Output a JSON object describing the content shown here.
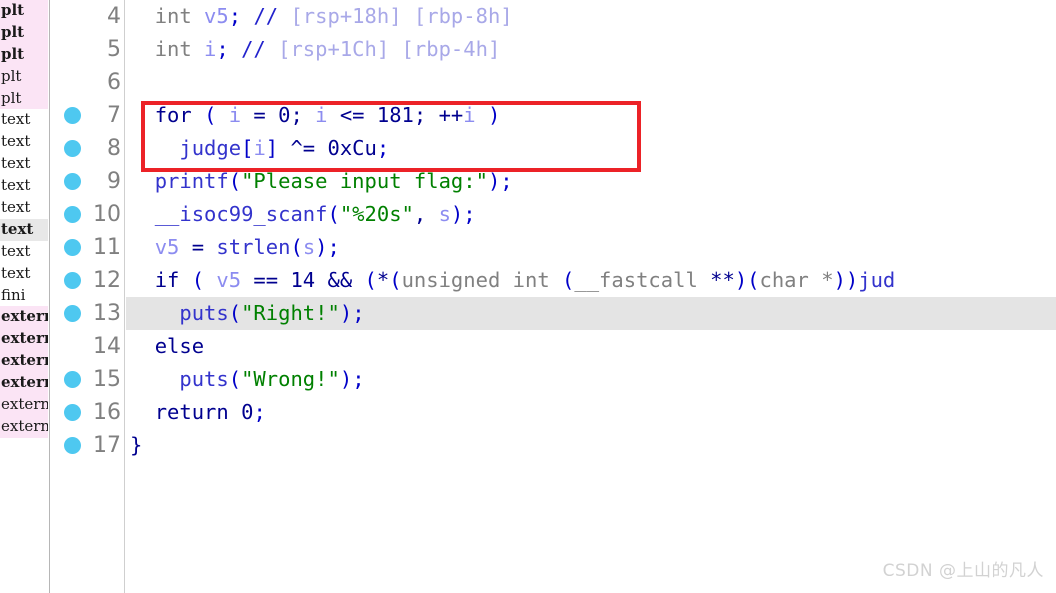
{
  "segment_strip": {
    "rows": [
      {
        "label": "plt",
        "style": "pink",
        "bold": true
      },
      {
        "label": "plt",
        "style": "pink",
        "bold": true
      },
      {
        "label": "plt",
        "style": "pink",
        "bold": true
      },
      {
        "label": "plt",
        "style": "pink",
        "bold": false
      },
      {
        "label": "plt",
        "style": "pink",
        "bold": false
      },
      {
        "label": "text",
        "style": "white",
        "bold": false
      },
      {
        "label": "text",
        "style": "white",
        "bold": false
      },
      {
        "label": "text",
        "style": "white",
        "bold": false
      },
      {
        "label": "text",
        "style": "white",
        "bold": false
      },
      {
        "label": "text",
        "style": "white",
        "bold": false
      },
      {
        "label": "text",
        "style": "gray",
        "bold": true
      },
      {
        "label": "text",
        "style": "white",
        "bold": false
      },
      {
        "label": "text",
        "style": "white",
        "bold": false
      },
      {
        "label": "fini",
        "style": "white",
        "bold": false
      },
      {
        "label": "extern",
        "style": "pink",
        "bold": true
      },
      {
        "label": "extern",
        "style": "pink",
        "bold": true
      },
      {
        "label": "extern",
        "style": "pink",
        "bold": true
      },
      {
        "label": "extern",
        "style": "pink",
        "bold": true
      },
      {
        "label": "extern",
        "style": "pink",
        "bold": false
      },
      {
        "label": "extern",
        "style": "pink",
        "bold": false
      }
    ]
  },
  "gutter": {
    "rows": [
      {
        "number": "4",
        "breakpoint": false
      },
      {
        "number": "5",
        "breakpoint": false
      },
      {
        "number": "6",
        "breakpoint": false
      },
      {
        "number": "7",
        "breakpoint": true
      },
      {
        "number": "8",
        "breakpoint": true
      },
      {
        "number": "9",
        "breakpoint": true
      },
      {
        "number": "10",
        "breakpoint": true
      },
      {
        "number": "11",
        "breakpoint": true
      },
      {
        "number": "12",
        "breakpoint": true
      },
      {
        "number": "13",
        "breakpoint": true
      },
      {
        "number": "14",
        "breakpoint": false
      },
      {
        "number": "15",
        "breakpoint": true
      },
      {
        "number": "16",
        "breakpoint": true
      },
      {
        "number": "17",
        "breakpoint": true
      }
    ]
  },
  "code": {
    "lines": [
      {
        "id": "line-4",
        "highlight": false,
        "text": "  int v5; // [rsp+18h] [rbp-8h]",
        "tokens": [
          {
            "t": "  ",
            "c": "t-plain"
          },
          {
            "t": "int",
            "c": "t-type"
          },
          {
            "t": " v5",
            "c": "t-var"
          },
          {
            "t": ";",
            "c": "t-punc"
          },
          {
            "t": " ",
            "c": "t-plain"
          },
          {
            "t": "//",
            "c": "t-cmt"
          },
          {
            "t": " ",
            "c": "t-plain"
          },
          {
            "t": "[rsp+18h] [rbp-8h]",
            "c": "t-cmtarg"
          }
        ]
      },
      {
        "id": "line-5",
        "highlight": false,
        "text": "  int i; // [rsp+1Ch] [rbp-4h]",
        "tokens": [
          {
            "t": "  ",
            "c": "t-plain"
          },
          {
            "t": "int",
            "c": "t-type"
          },
          {
            "t": " i",
            "c": "t-var"
          },
          {
            "t": ";",
            "c": "t-punc"
          },
          {
            "t": " ",
            "c": "t-plain"
          },
          {
            "t": "//",
            "c": "t-cmt"
          },
          {
            "t": " ",
            "c": "t-plain"
          },
          {
            "t": "[rsp+1Ch] [rbp-4h]",
            "c": "t-cmtarg"
          }
        ]
      },
      {
        "id": "line-6",
        "highlight": false,
        "text": "",
        "tokens": []
      },
      {
        "id": "line-7",
        "highlight": false,
        "text": "  for ( i = 0; i <= 181; ++i )",
        "tokens": [
          {
            "t": "  ",
            "c": "t-plain"
          },
          {
            "t": "for",
            "c": "t-kw"
          },
          {
            "t": " ",
            "c": "t-plain"
          },
          {
            "t": "(",
            "c": "t-punc"
          },
          {
            "t": " ",
            "c": "t-plain"
          },
          {
            "t": "i",
            "c": "t-var"
          },
          {
            "t": " = ",
            "c": "t-plain"
          },
          {
            "t": "0",
            "c": "t-num"
          },
          {
            "t": "; ",
            "c": "t-plain"
          },
          {
            "t": "i",
            "c": "t-var"
          },
          {
            "t": " <= ",
            "c": "t-plain"
          },
          {
            "t": "181",
            "c": "t-num"
          },
          {
            "t": "; ++",
            "c": "t-plain"
          },
          {
            "t": "i",
            "c": "t-var"
          },
          {
            "t": " ",
            "c": "t-plain"
          },
          {
            "t": ")",
            "c": "t-punc"
          }
        ]
      },
      {
        "id": "line-8",
        "highlight": false,
        "text": "    judge[i] ^= 0xCu;",
        "tokens": [
          {
            "t": "    ",
            "c": "t-plain"
          },
          {
            "t": "judge",
            "c": "t-func"
          },
          {
            "t": "[",
            "c": "t-punc"
          },
          {
            "t": "i",
            "c": "t-var"
          },
          {
            "t": "]",
            "c": "t-punc"
          },
          {
            "t": " ^= ",
            "c": "t-plain"
          },
          {
            "t": "0xCu",
            "c": "t-num"
          },
          {
            "t": ";",
            "c": "t-punc"
          }
        ]
      },
      {
        "id": "line-9",
        "highlight": false,
        "text": "  printf(\"Please input flag:\");",
        "tokens": [
          {
            "t": "  ",
            "c": "t-plain"
          },
          {
            "t": "printf",
            "c": "t-func"
          },
          {
            "t": "(",
            "c": "t-punc"
          },
          {
            "t": "\"Please input flag:\"",
            "c": "t-str"
          },
          {
            "t": ")",
            "c": "t-punc"
          },
          {
            "t": ";",
            "c": "t-punc"
          }
        ]
      },
      {
        "id": "line-10",
        "highlight": false,
        "text": "  __isoc99_scanf(\"%20s\", s);",
        "tokens": [
          {
            "t": "  ",
            "c": "t-plain"
          },
          {
            "t": "__isoc99_scanf",
            "c": "t-func"
          },
          {
            "t": "(",
            "c": "t-punc"
          },
          {
            "t": "\"%20s\"",
            "c": "t-str"
          },
          {
            "t": ", ",
            "c": "t-plain"
          },
          {
            "t": "s",
            "c": "t-var"
          },
          {
            "t": ")",
            "c": "t-punc"
          },
          {
            "t": ";",
            "c": "t-punc"
          }
        ]
      },
      {
        "id": "line-11",
        "highlight": false,
        "text": "  v5 = strlen(s);",
        "tokens": [
          {
            "t": "  ",
            "c": "t-plain"
          },
          {
            "t": "v5",
            "c": "t-var"
          },
          {
            "t": " = ",
            "c": "t-plain"
          },
          {
            "t": "strlen",
            "c": "t-func"
          },
          {
            "t": "(",
            "c": "t-punc"
          },
          {
            "t": "s",
            "c": "t-var"
          },
          {
            "t": ")",
            "c": "t-punc"
          },
          {
            "t": ";",
            "c": "t-punc"
          }
        ]
      },
      {
        "id": "line-12",
        "highlight": false,
        "text": "  if ( v5 == 14 && (*(unsigned int (__fastcall **)(char *))jud",
        "tokens": [
          {
            "t": "  ",
            "c": "t-plain"
          },
          {
            "t": "if",
            "c": "t-kw"
          },
          {
            "t": " ",
            "c": "t-plain"
          },
          {
            "t": "(",
            "c": "t-punc"
          },
          {
            "t": " ",
            "c": "t-plain"
          },
          {
            "t": "v5",
            "c": "t-var"
          },
          {
            "t": " == ",
            "c": "t-plain"
          },
          {
            "t": "14",
            "c": "t-num"
          },
          {
            "t": " && ",
            "c": "t-plain"
          },
          {
            "t": "(",
            "c": "t-punc"
          },
          {
            "t": "*",
            "c": "t-plain"
          },
          {
            "t": "(",
            "c": "t-punc"
          },
          {
            "t": "unsigned int",
            "c": "t-gray"
          },
          {
            "t": " ",
            "c": "t-plain"
          },
          {
            "t": "(",
            "c": "t-punc"
          },
          {
            "t": "__fastcall",
            "c": "t-gray"
          },
          {
            "t": " ",
            "c": "t-plain"
          },
          {
            "t": "**",
            "c": "t-plain"
          },
          {
            "t": ")",
            "c": "t-punc"
          },
          {
            "t": "(",
            "c": "t-punc"
          },
          {
            "t": "char",
            "c": "t-gray"
          },
          {
            "t": " ",
            "c": "t-plain"
          },
          {
            "t": "*",
            "c": "t-gray"
          },
          {
            "t": ")",
            "c": "t-punc"
          },
          {
            "t": ")",
            "c": "t-punc"
          },
          {
            "t": "jud",
            "c": "t-func"
          }
        ]
      },
      {
        "id": "line-13",
        "highlight": true,
        "text": "    puts(\"Right!\");",
        "tokens": [
          {
            "t": "    ",
            "c": "t-plain"
          },
          {
            "t": "puts",
            "c": "t-func"
          },
          {
            "t": "(",
            "c": "t-punc"
          },
          {
            "t": "\"Right!\"",
            "c": "t-str"
          },
          {
            "t": ")",
            "c": "t-punc"
          },
          {
            "t": ";",
            "c": "t-punc"
          }
        ]
      },
      {
        "id": "line-14",
        "highlight": false,
        "text": "  else",
        "tokens": [
          {
            "t": "  ",
            "c": "t-plain"
          },
          {
            "t": "else",
            "c": "t-kw"
          }
        ]
      },
      {
        "id": "line-15",
        "highlight": false,
        "text": "    puts(\"Wrong!\");",
        "tokens": [
          {
            "t": "    ",
            "c": "t-plain"
          },
          {
            "t": "puts",
            "c": "t-func"
          },
          {
            "t": "(",
            "c": "t-punc"
          },
          {
            "t": "\"Wrong!\"",
            "c": "t-str"
          },
          {
            "t": ")",
            "c": "t-punc"
          },
          {
            "t": ";",
            "c": "t-punc"
          }
        ]
      },
      {
        "id": "line-16",
        "highlight": false,
        "text": "  return 0;",
        "tokens": [
          {
            "t": "  ",
            "c": "t-plain"
          },
          {
            "t": "return",
            "c": "t-kw"
          },
          {
            "t": " ",
            "c": "t-plain"
          },
          {
            "t": "0",
            "c": "t-num"
          },
          {
            "t": ";",
            "c": "t-punc"
          }
        ]
      },
      {
        "id": "line-17",
        "highlight": false,
        "text": "}",
        "tokens": [
          {
            "t": "}",
            "c": "t-brace"
          }
        ]
      }
    ]
  },
  "annotation": {
    "red_box_color": "#ec2227",
    "covers_lines": "7-8"
  },
  "watermark": {
    "text": "CSDN @上山的凡人"
  },
  "colors": {
    "breakpoint_dot": "#4ec8f0",
    "segment_pink": "#fbe4f5",
    "current_line_highlight": "#e4e4e4",
    "string": "#008000",
    "keyword": "#00008f",
    "variable": "#8c8cf0",
    "type": "#808080"
  }
}
